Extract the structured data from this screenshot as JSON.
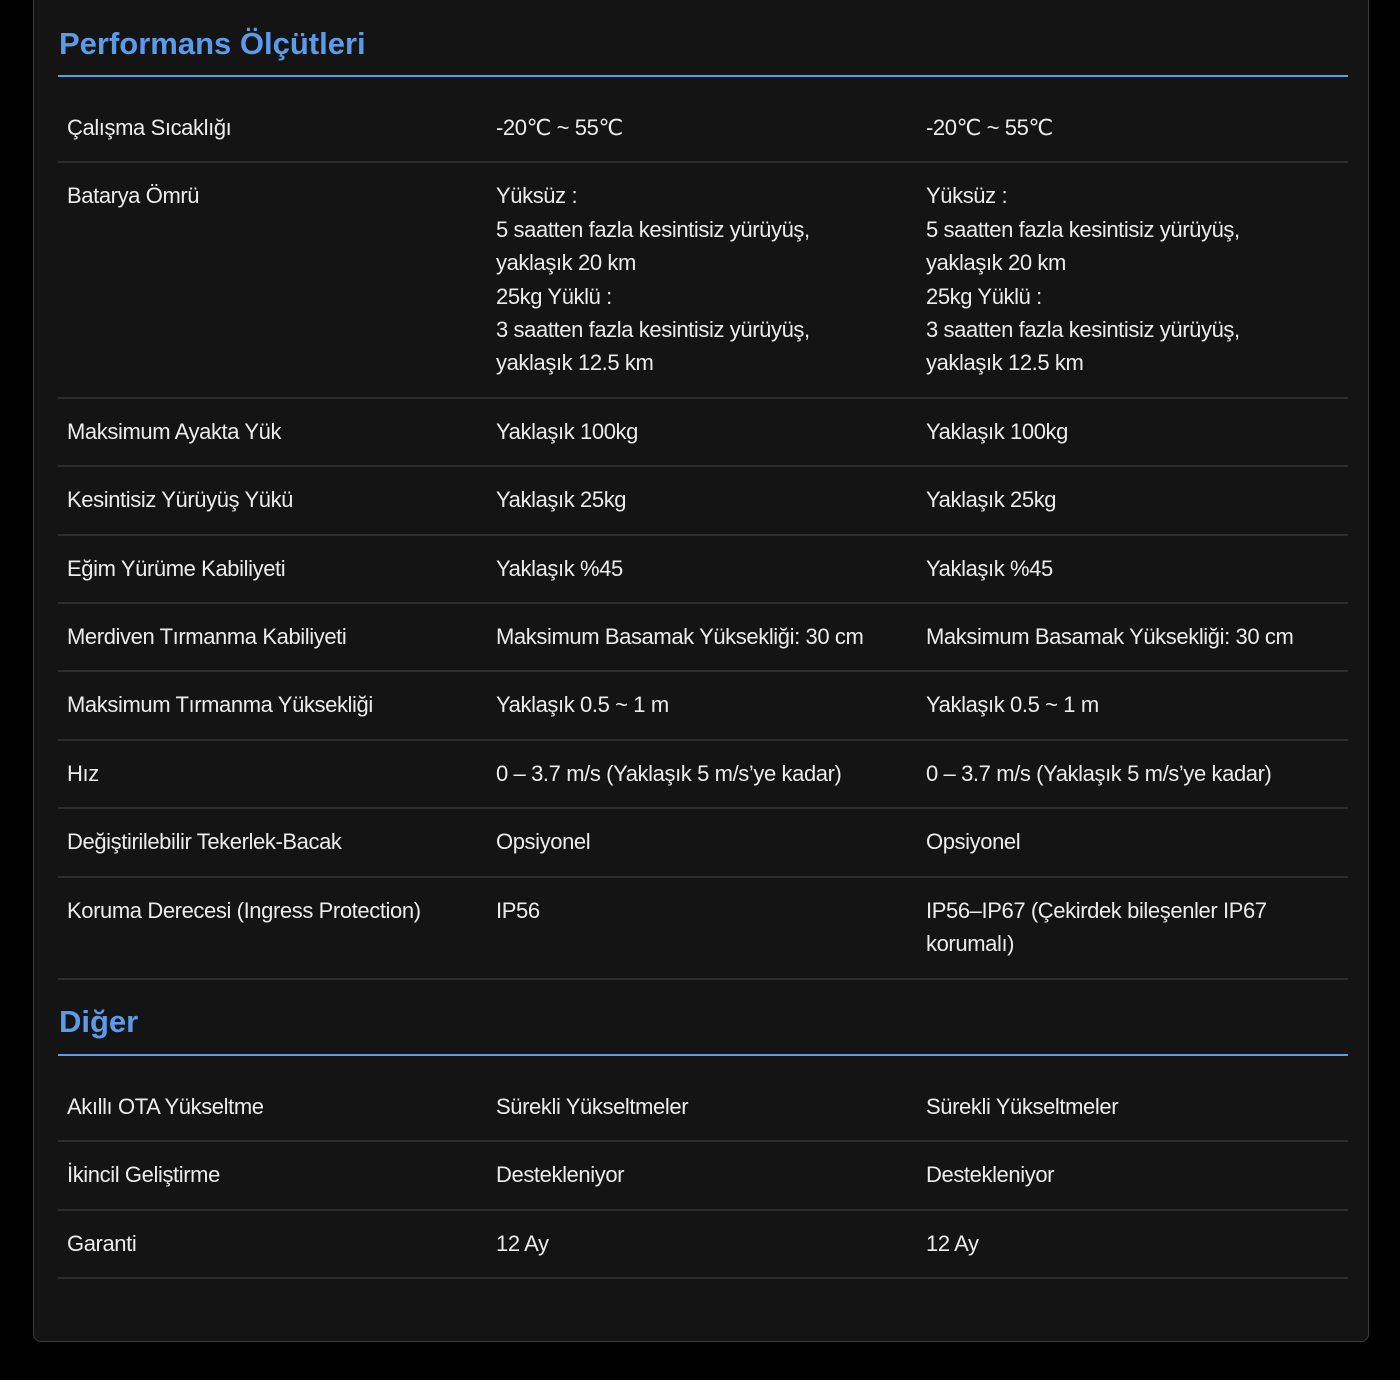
{
  "sections": [
    {
      "title": "Performans Ölçütleri",
      "rows": [
        [
          "Çalışma Sıcaklığı",
          "-20℃ ~ 55℃",
          "-20℃ ~ 55℃"
        ],
        [
          "Batarya Ömrü",
          "Yüksüz :\n5 saatten fazla kesintisiz yürüyüş,\nyaklaşık 20 km\n25kg Yüklü :\n3 saatten fazla kesintisiz yürüyüş,\nyaklaşık 12.5 km",
          "Yüksüz :\n5 saatten fazla kesintisiz yürüyüş,\nyaklaşık 20 km\n25kg Yüklü :\n3 saatten fazla kesintisiz yürüyüş,\nyaklaşık 12.5 km"
        ],
        [
          "Maksimum Ayakta Yük",
          "Yaklaşık 100kg",
          "Yaklaşık 100kg"
        ],
        [
          "Kesintisiz Yürüyüş Yükü",
          "Yaklaşık 25kg",
          "Yaklaşık 25kg"
        ],
        [
          "Eğim Yürüme Kabiliyeti",
          "Yaklaşık %45",
          "Yaklaşık %45"
        ],
        [
          "Merdiven Tırmanma Kabiliyeti",
          "Maksimum Basamak Yüksekliği: 30 cm",
          "Maksimum Basamak Yüksekliği: 30 cm"
        ],
        [
          "Maksimum Tırmanma Yüksekliği",
          "Yaklaşık 0.5 ~ 1 m",
          "Yaklaşık 0.5 ~ 1 m"
        ],
        [
          "Hız",
          "0 – 3.7 m/s (Yaklaşık 5 m/s’ye kadar)",
          "0 – 3.7 m/s (Yaklaşık 5 m/s’ye kadar)"
        ],
        [
          "Değiştirilebilir Tekerlek-Bacak",
          "Opsiyonel",
          "Opsiyonel"
        ],
        [
          "Koruma Derecesi (Ingress Protection)",
          "IP56",
          "IP56–IP67 (Çekirdek bileşenler IP67 korumalı)"
        ]
      ]
    },
    {
      "title": "Diğer",
      "rows": [
        [
          "Akıllı OTA Yükseltme",
          "Sürekli Yükseltmeler",
          "Sürekli Yükseltmeler"
        ],
        [
          "İkincil Geliştirme",
          "Destekleniyor",
          "Destekleniyor"
        ],
        [
          "Garanti",
          "12 Ay",
          "12 Ay"
        ]
      ]
    }
  ],
  "colors": {
    "page_background": "#000000",
    "card_background": "#141414",
    "accent": "#5b9bea",
    "text": "#ececec",
    "row_divider": "#2e2e2e"
  }
}
